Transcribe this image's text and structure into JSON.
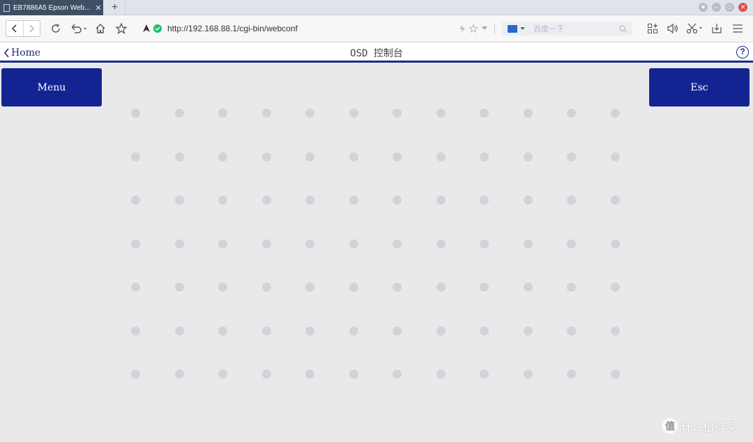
{
  "browser": {
    "tab_title": "EB7886A5 Epson Web...",
    "tab_close": "✕",
    "new_tab": "+",
    "url": "http://192.168.88.1/cgi-bin/webconf",
    "search_placeholder": "百度一下"
  },
  "header": {
    "back_label": "Home",
    "title": "OSD 控制台",
    "help": "?"
  },
  "controls": {
    "menu_label": "Menu",
    "esc_label": "Esc"
  },
  "dot_grid": {
    "rows": 7,
    "cols": 12,
    "color": "#d1d3dc"
  },
  "watermark": {
    "mark": "值",
    "text": "什么值得买"
  },
  "colors": {
    "accent": "#132492",
    "background": "#e9e9e9"
  }
}
